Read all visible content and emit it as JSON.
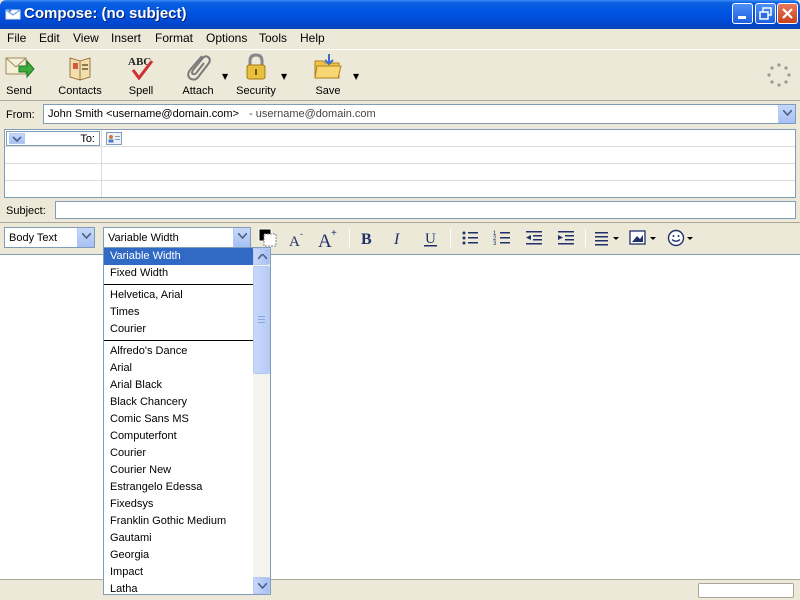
{
  "window": {
    "title": "Compose: (no subject)"
  },
  "menu": [
    "File",
    "Edit",
    "View",
    "Insert",
    "Format",
    "Options",
    "Tools",
    "Help"
  ],
  "toolbar": {
    "send": "Send",
    "contacts": "Contacts",
    "spell": "Spell",
    "attach": "Attach",
    "security": "Security",
    "save": "Save"
  },
  "from": {
    "label": "From:",
    "value": "John Smith <username@domain.com>",
    "account": "- username@domain.com"
  },
  "addressing": {
    "type_label": "To:"
  },
  "subject": {
    "label": "Subject:",
    "value": ""
  },
  "format": {
    "paragraph_style": "Body Text",
    "font": "Variable Width"
  },
  "font_list": {
    "group1": [
      "Variable Width",
      "Fixed Width"
    ],
    "group2": [
      "Helvetica, Arial",
      "Times",
      "Courier"
    ],
    "group3": [
      "Alfredo's Dance",
      "Arial",
      "Arial Black",
      "Black Chancery",
      "Comic Sans MS",
      "Computerfont",
      "Courier",
      "Courier New",
      "Estrangelo Edessa",
      "Fixedsys",
      "Franklin Gothic Medium",
      "Gautami",
      "Georgia",
      "Impact",
      "Latha"
    ],
    "selected": "Variable Width"
  },
  "colors": {
    "selection": "#316ac5",
    "titlebar": "#0054e3"
  }
}
